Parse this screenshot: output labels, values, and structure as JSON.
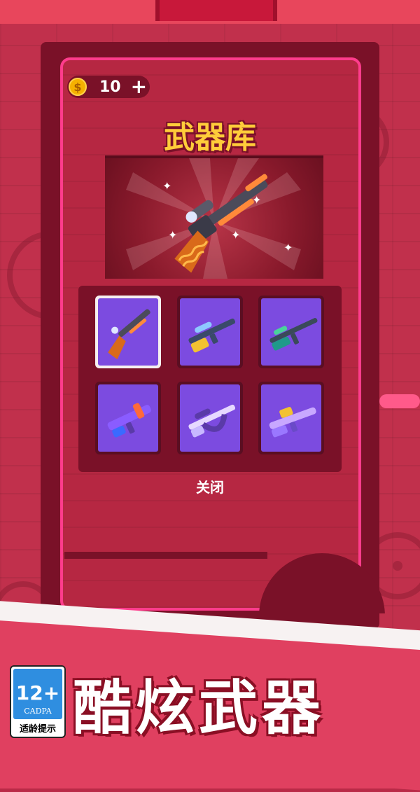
{
  "header": {
    "coins": "10",
    "coin_symbol": "$",
    "plus": "+"
  },
  "armory": {
    "title": "武器库",
    "close_label": "关闭"
  },
  "weapons": [
    {
      "name": "shotgun",
      "selected": true
    },
    {
      "name": "sniper-rifle",
      "selected": false
    },
    {
      "name": "assault-rifle",
      "selected": false
    },
    {
      "name": "blaster-smg",
      "selected": false
    },
    {
      "name": "heavy-rifle",
      "selected": false
    },
    {
      "name": "toy-rifle",
      "selected": false
    }
  ],
  "footer": {
    "age_rating": "12+",
    "rating_org": "CADPA",
    "rating_note": "适龄提示",
    "slogan": "酷炫武器"
  },
  "colors": {
    "accent": "#ff3c8c",
    "title": "#ffcc3a",
    "slot": "#7c4be0",
    "background": "#c1304c"
  }
}
